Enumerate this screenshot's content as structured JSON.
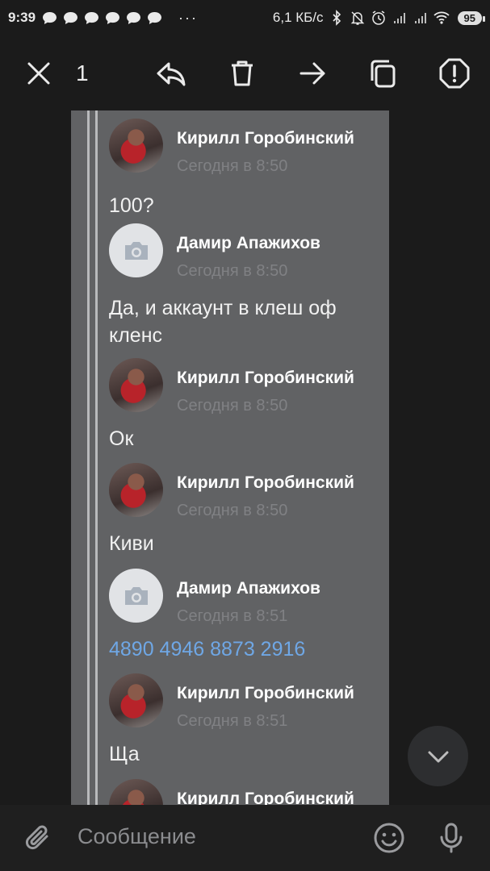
{
  "status_bar": {
    "time": "9:39",
    "dots": "···",
    "speed": "6,1 КБ/с",
    "battery": "95"
  },
  "toolbar": {
    "selected_count": "1"
  },
  "messages": [
    {
      "author": "Кирилл Горобинский",
      "time": "Сегодня в 8:50",
      "text": "100?",
      "avatar": "photo"
    },
    {
      "author": "Дамир Апажихов",
      "time": "Сегодня в 8:50",
      "text": "Да, и аккаунт в клеш оф кленс",
      "avatar": "camera-placeholder"
    },
    {
      "author": "Кирилл Горобинский",
      "time": "Сегодня в 8:50",
      "text": "Ок",
      "avatar": "photo"
    },
    {
      "author": "Кирилл Горобинский",
      "time": "Сегодня в 8:50",
      "text": "Киви",
      "avatar": "photo"
    },
    {
      "author": "Дамир Апажихов",
      "time": "Сегодня в 8:51",
      "text": "4890 4946 8873 2916",
      "avatar": "camera-placeholder",
      "is_link": true
    },
    {
      "author": "Кирилл Горобинский",
      "time": "Сегодня в 8:51",
      "text": "Ща",
      "avatar": "photo"
    },
    {
      "author": "Кирилл Горобинский",
      "time": "",
      "text": "",
      "avatar": "photo"
    }
  ],
  "composer": {
    "placeholder": "Сообщение"
  },
  "colors": {
    "background": "#1b1b1b",
    "panel": "#616264",
    "link": "#6fa7e5",
    "muted": "#808184"
  }
}
